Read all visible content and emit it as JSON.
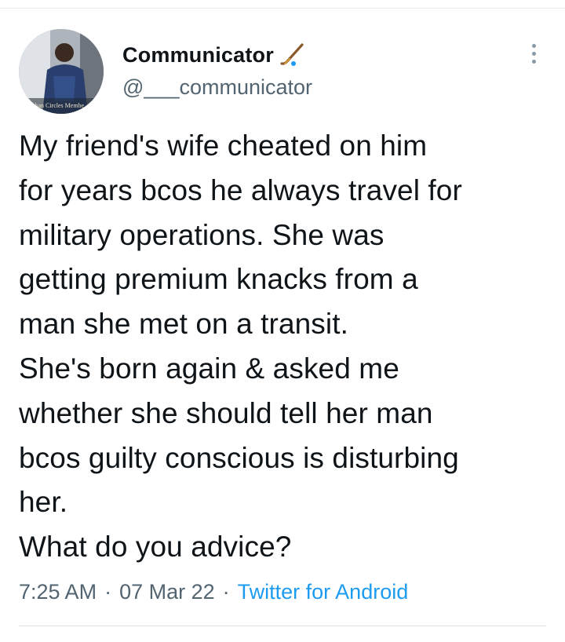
{
  "tweet": {
    "author": {
      "display_name": "Communicator",
      "name_emoji_icon": "hockey-stick-icon",
      "handle": "@___communicator",
      "avatar_caption": "Urban Circles Membe"
    },
    "text": "My friend's wife cheated on him\nfor years bcos he always travel for\nmilitary operations. She was\ngetting premium knacks from a\nman she met on a transit.\nShe's born again & asked me\nwhether she should tell her man\nbcos guilty conscious is disturbing\nher.\nWhat do you advice?",
    "time": "7:25 AM",
    "separator": "·",
    "date": "07 Mar 22",
    "source": "Twitter for Android"
  },
  "colors": {
    "text": "#0f1419",
    "secondary": "#536471",
    "link": "#1d9bf0",
    "divider": "#e6ecf0"
  }
}
